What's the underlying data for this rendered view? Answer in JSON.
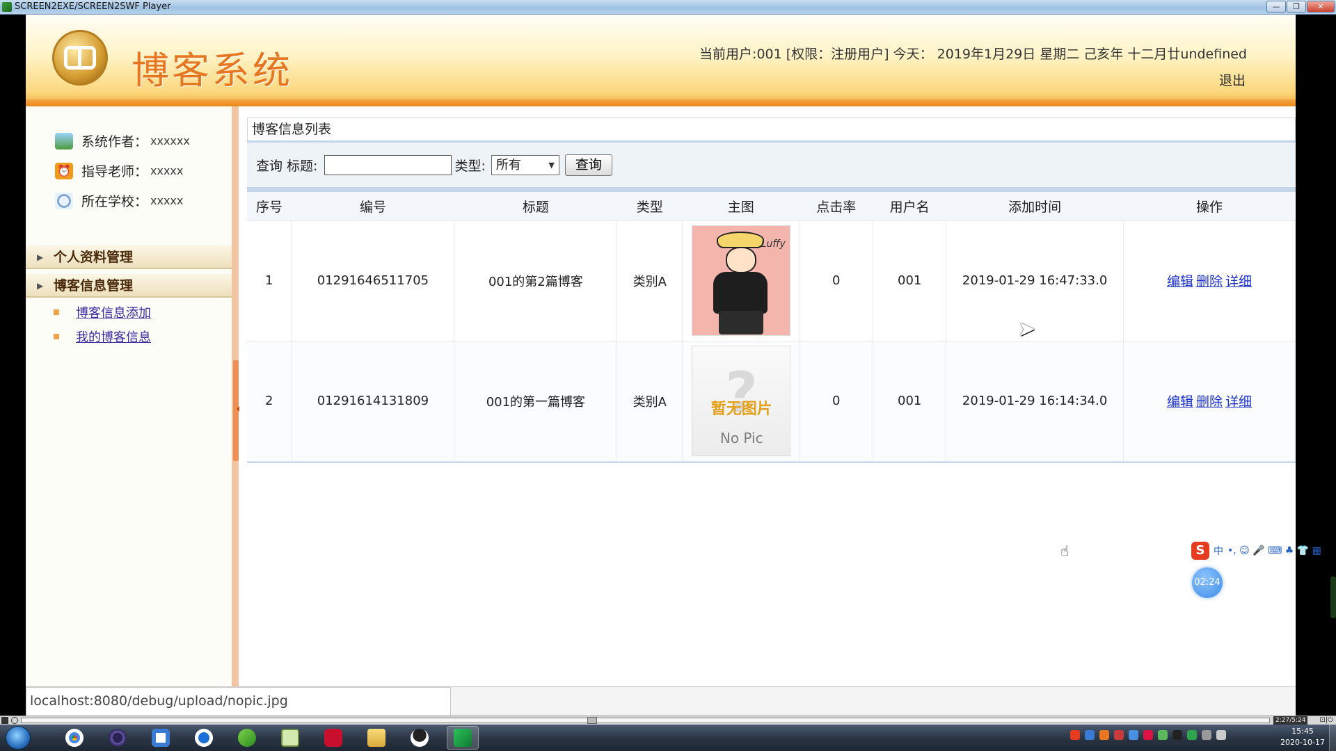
{
  "player": {
    "title": "SCREEN2EXE/SCREEN2SWF Player",
    "timecode": "2:27/5:24",
    "controls_glyphs": "⊡|⏻"
  },
  "window_buttons": {
    "minimize": "—",
    "maximize": "❐",
    "close": "✕"
  },
  "header": {
    "site_title": "博客系统",
    "user_info": "当前用户:001 [权限：注册用户] 今天： 2019年1月29日 星期二 己亥年 十二月廿undefined",
    "logout": "退出"
  },
  "sidebar": {
    "info": [
      {
        "label": "系统作者：",
        "value": "xxxxxx"
      },
      {
        "label": "指导老师：",
        "value": "xxxxx"
      },
      {
        "label": "所在学校：",
        "value": "xxxxx"
      }
    ],
    "menus": [
      {
        "label": "个人资料管理"
      },
      {
        "label": "博客信息管理"
      }
    ],
    "subitems": [
      {
        "label": "博客信息添加"
      },
      {
        "label": "我的博客信息"
      }
    ]
  },
  "content": {
    "panel_title": "博客信息列表",
    "search": {
      "title_label": "查询 标题:",
      "title_value": "",
      "type_label": "类型:",
      "type_selected": "所有",
      "query_button": "查询"
    },
    "table": {
      "headers": [
        "序号",
        "编号",
        "标题",
        "类型",
        "主图",
        "点击率",
        "用户名",
        "添加时间",
        "操作"
      ],
      "rows": [
        {
          "seq": "1",
          "id": "01291646511705",
          "title": "001的第2篇博客",
          "type": "类别A",
          "image_signature": "Luffy",
          "clicks": "0",
          "user": "001",
          "time": "2019-01-29 16:47:33.0"
        },
        {
          "seq": "2",
          "id": "01291614131809",
          "title": "001的第一篇博客",
          "type": "类别A",
          "nopic_cn": "暂无图片",
          "nopic_en": "No Pic",
          "clicks": "0",
          "user": "001",
          "time": "2019-01-29 16:14:34.0"
        }
      ],
      "actions": {
        "edit": "编辑",
        "delete": "删除",
        "detail": "详细"
      }
    }
  },
  "status": {
    "url": "localhost:8080/debug/upload/nopic.jpg"
  },
  "ime": {
    "logo": "S",
    "mode": "中",
    "icons": "•, ☺ 🎤 ⌨ ♣ 👕 ▦"
  },
  "timer": "02:24",
  "taskbar": {
    "time": "15:45",
    "date": "2020-10-17"
  },
  "colors": {
    "accent_orange": "#e6761f",
    "link_blue": "#1a2fd0",
    "sub_link": "#3a2ca0"
  }
}
